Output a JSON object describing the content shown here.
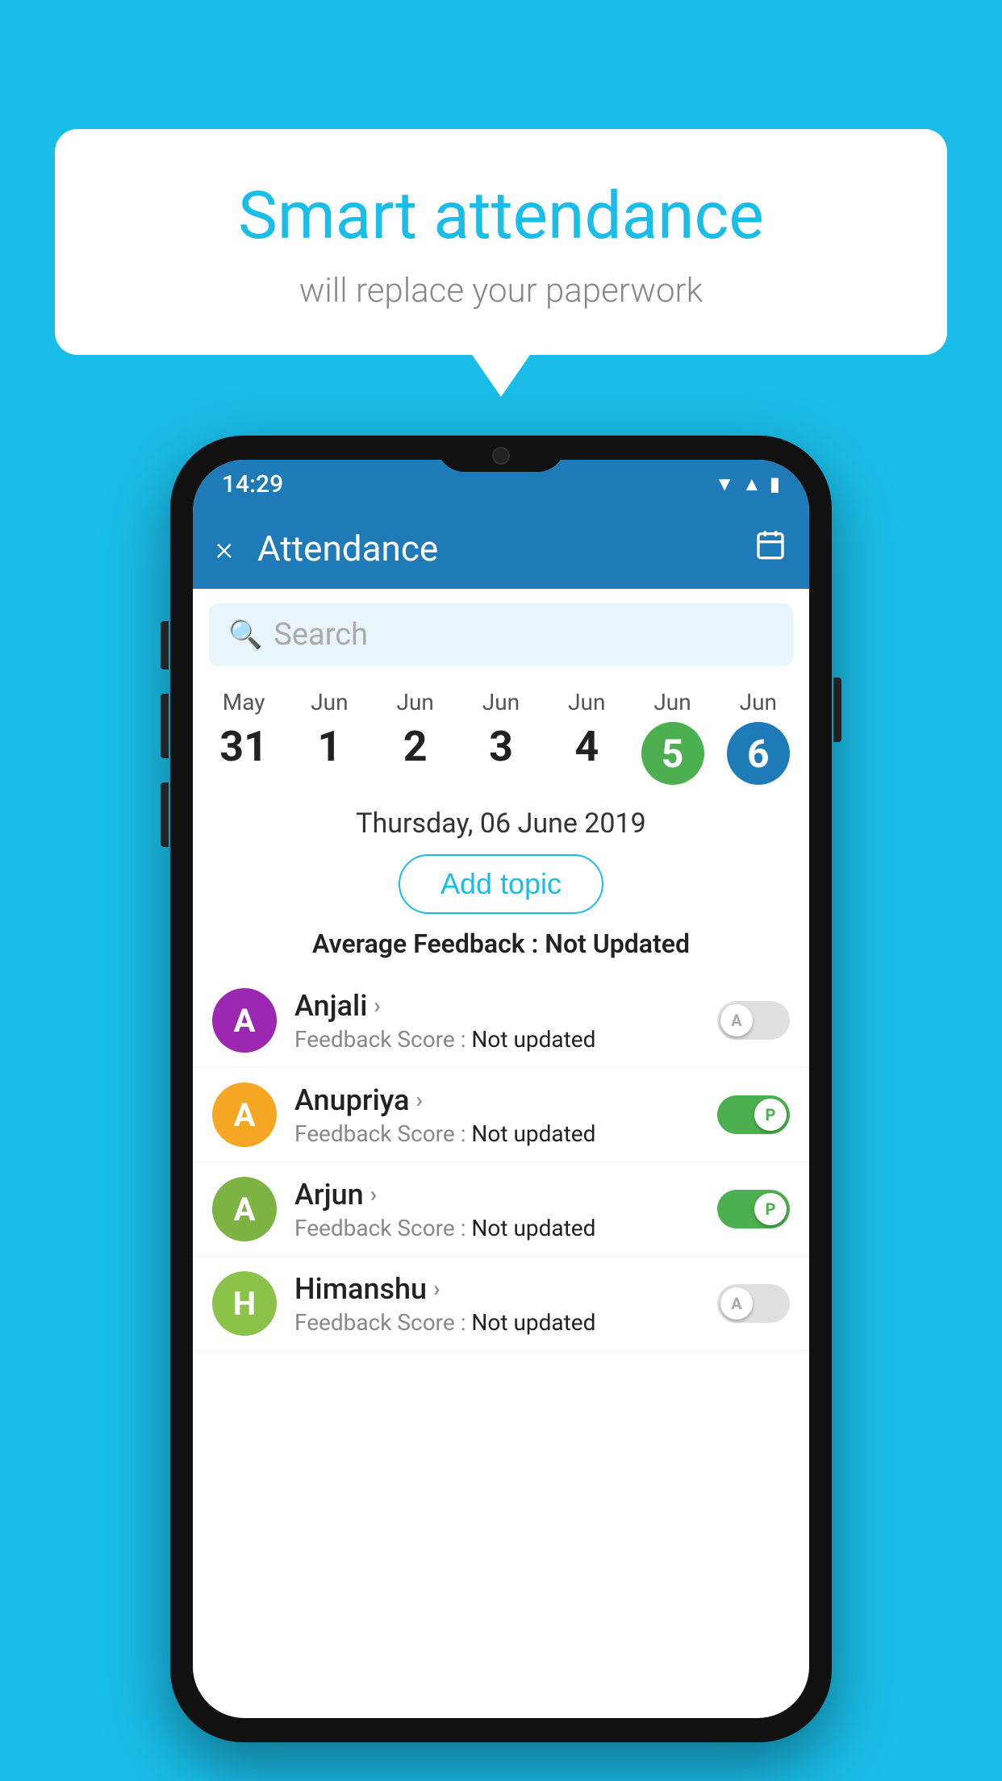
{
  "background_color": "#1ABDE8",
  "bubble": {
    "title": "Smart attendance",
    "subtitle": "will replace your paperwork"
  },
  "phone": {
    "status_bar": {
      "time": "14:29",
      "icons": [
        "wifi",
        "signal",
        "battery"
      ]
    },
    "toolbar": {
      "close_label": "×",
      "title": "Attendance",
      "calendar_icon": "📅"
    },
    "search": {
      "placeholder": "Search"
    },
    "date_strip": [
      {
        "month": "May",
        "day": "31",
        "active": false,
        "color": null
      },
      {
        "month": "Jun",
        "day": "1",
        "active": false,
        "color": null
      },
      {
        "month": "Jun",
        "day": "2",
        "active": false,
        "color": null
      },
      {
        "month": "Jun",
        "day": "3",
        "active": false,
        "color": null
      },
      {
        "month": "Jun",
        "day": "4",
        "active": false,
        "color": null
      },
      {
        "month": "Jun",
        "day": "5",
        "active": true,
        "color": "green"
      },
      {
        "month": "Jun",
        "day": "6",
        "active": true,
        "color": "blue"
      }
    ],
    "selected_date": "Thursday, 06 June 2019",
    "add_topic_label": "Add topic",
    "avg_feedback_label": "Average Feedback :",
    "avg_feedback_value": "Not Updated",
    "students": [
      {
        "name": "Anjali",
        "avatar_letter": "A",
        "avatar_color": "#9C27B0",
        "feedback_label": "Feedback Score :",
        "feedback_value": "Not updated",
        "toggle": "off",
        "toggle_letter": "A"
      },
      {
        "name": "Anupriya",
        "avatar_letter": "A",
        "avatar_color": "#F5A623",
        "feedback_label": "Feedback Score :",
        "feedback_value": "Not updated",
        "toggle": "on",
        "toggle_letter": "P"
      },
      {
        "name": "Arjun",
        "avatar_letter": "A",
        "avatar_color": "#7CB342",
        "feedback_label": "Feedback Score :",
        "feedback_value": "Not updated",
        "toggle": "on",
        "toggle_letter": "P"
      },
      {
        "name": "Himanshu",
        "avatar_letter": "H",
        "avatar_color": "#8BC34A",
        "feedback_label": "Feedback Score :",
        "feedback_value": "Not updated",
        "toggle": "off",
        "toggle_letter": "A"
      }
    ]
  }
}
